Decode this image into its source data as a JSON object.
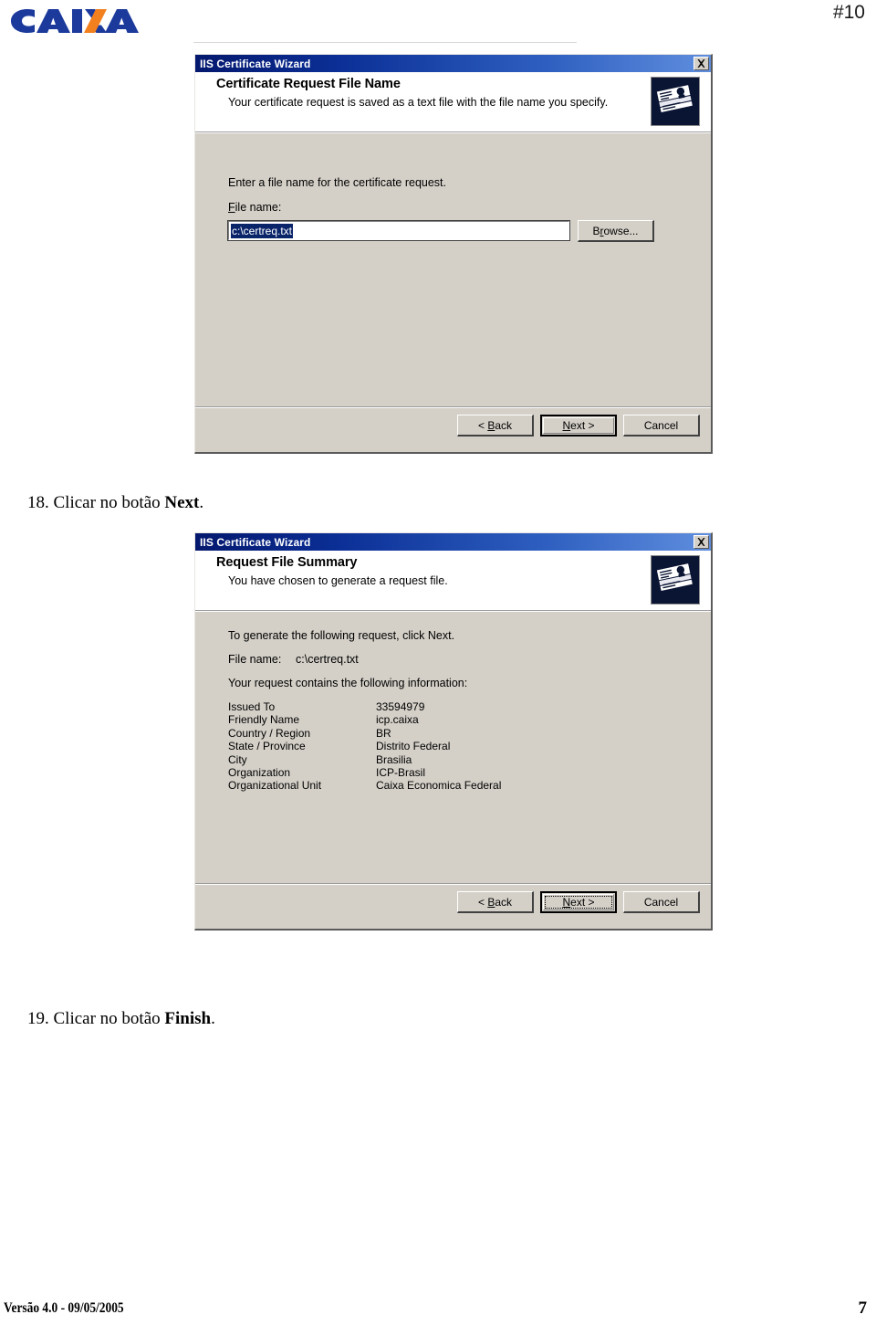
{
  "page": {
    "marker": "#10",
    "logo_alt": "CAIXA",
    "logo_blue": "#1b3a9c",
    "logo_orange": "#f2801e"
  },
  "footer": {
    "left": "Versão 4.0 - 09/05/2005",
    "page_number": "7"
  },
  "steps": [
    {
      "number": "18.",
      "text": "Clicar no botão ",
      "bold": "Next",
      "tail": "."
    },
    {
      "number": "19.",
      "text": "Clicar no botão ",
      "bold": "Finish",
      "tail": "."
    }
  ],
  "dialog1": {
    "title": "IIS Certificate Wizard",
    "close_label": "Close",
    "heading": "Certificate Request File Name",
    "description": "Your certificate request is saved as a text file with the file name you specify.",
    "icon_name": "certificate-stack-icon",
    "prompt": "Enter a file name for the certificate request.",
    "field_label": "File name:",
    "field_label_accesskey": "F",
    "field_value": "c:\\certreq.txt",
    "browse_label": "Browse...",
    "browse_accesskey": "r",
    "buttons": {
      "back": "< Back",
      "back_accesskey": "B",
      "next": "Next >",
      "next_accesskey": "N",
      "cancel": "Cancel"
    }
  },
  "dialog2": {
    "title": "IIS Certificate Wizard",
    "close_label": "Close",
    "heading": "Request File Summary",
    "description": "You have chosen to generate a request file.",
    "icon_name": "certificate-stack-icon",
    "intro": "To generate the following request, click Next.",
    "file_name_label": "File name:",
    "file_name_value": "c:\\certreq.txt",
    "contains_label": "Your request contains the following information:",
    "summary_rows": [
      {
        "key": "Issued To",
        "value": "33594979"
      },
      {
        "key": "Friendly Name",
        "value": "icp.caixa"
      },
      {
        "key": "Country / Region",
        "value": "BR"
      },
      {
        "key": "State / Province",
        "value": "Distrito Federal"
      },
      {
        "key": "City",
        "value": "Brasilia"
      },
      {
        "key": "Organization",
        "value": "ICP-Brasil"
      },
      {
        "key": "Organizational Unit",
        "value": "Caixa Economica Federal"
      }
    ],
    "buttons": {
      "back": "< Back",
      "back_accesskey": "B",
      "next": "Next >",
      "next_accesskey": "N",
      "cancel": "Cancel"
    }
  }
}
